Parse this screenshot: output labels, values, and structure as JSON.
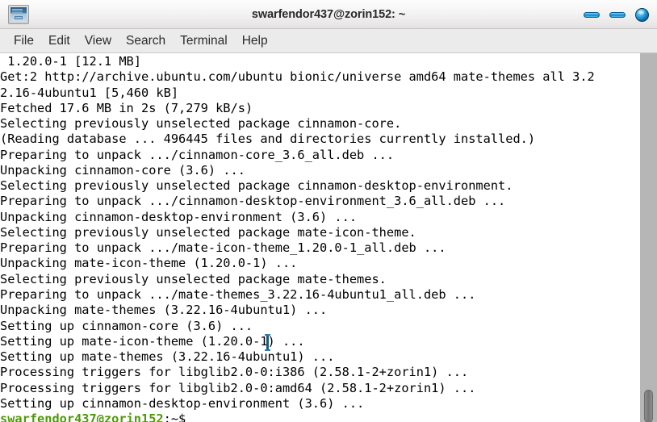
{
  "window": {
    "title": "swarfendor437@zorin152: ~",
    "app_icon": "terminal-icon",
    "controls": {
      "minimize": "minimize",
      "maximize": "maximize",
      "close": "close"
    }
  },
  "menubar": {
    "items": [
      {
        "label": "File"
      },
      {
        "label": "Edit"
      },
      {
        "label": "View"
      },
      {
        "label": "Search"
      },
      {
        "label": "Terminal"
      },
      {
        "label": "Help"
      }
    ]
  },
  "terminal": {
    "background_color": "#ffffff",
    "foreground_color": "#000000",
    "prompt_color": "#4e9a06",
    "lines": [
      " 1.20.0-1 [12.1 MB]",
      "Get:2 http://archive.ubuntu.com/ubuntu bionic/universe amd64 mate-themes all 3.2",
      "2.16-4ubuntu1 [5,460 kB]",
      "Fetched 17.6 MB in 2s (7,279 kB/s)",
      "Selecting previously unselected package cinnamon-core.",
      "(Reading database ... 496445 files and directories currently installed.)",
      "Preparing to unpack .../cinnamon-core_3.6_all.deb ...",
      "Unpacking cinnamon-core (3.6) ...",
      "Selecting previously unselected package cinnamon-desktop-environment.",
      "Preparing to unpack .../cinnamon-desktop-environment_3.6_all.deb ...",
      "Unpacking cinnamon-desktop-environment (3.6) ...",
      "Selecting previously unselected package mate-icon-theme.",
      "Preparing to unpack .../mate-icon-theme_1.20.0-1_all.deb ...",
      "Unpacking mate-icon-theme (1.20.0-1) ...",
      "Selecting previously unselected package mate-themes.",
      "Preparing to unpack .../mate-themes_3.22.16-4ubuntu1_all.deb ...",
      "Unpacking mate-themes (3.22.16-4ubuntu1) ...",
      "Setting up cinnamon-core (3.6) ...",
      "Setting up mate-icon-theme (1.20.0-1) ...",
      "Setting up mate-themes (3.22.16-4ubuntu1) ...",
      "Processing triggers for libglib2.0-0:i386 (2.58.1-2+zorin1) ...",
      "Processing triggers for libglib2.0-0:amd64 (2.58.1-2+zorin1) ...",
      "Setting up cinnamon-desktop-environment (3.6) ..."
    ],
    "prompt": {
      "user_host": "swarfendor437@zorin152",
      "tail": ":~$"
    }
  },
  "scrollbar": {
    "orientation": "vertical",
    "thumb_position": "bottom"
  }
}
